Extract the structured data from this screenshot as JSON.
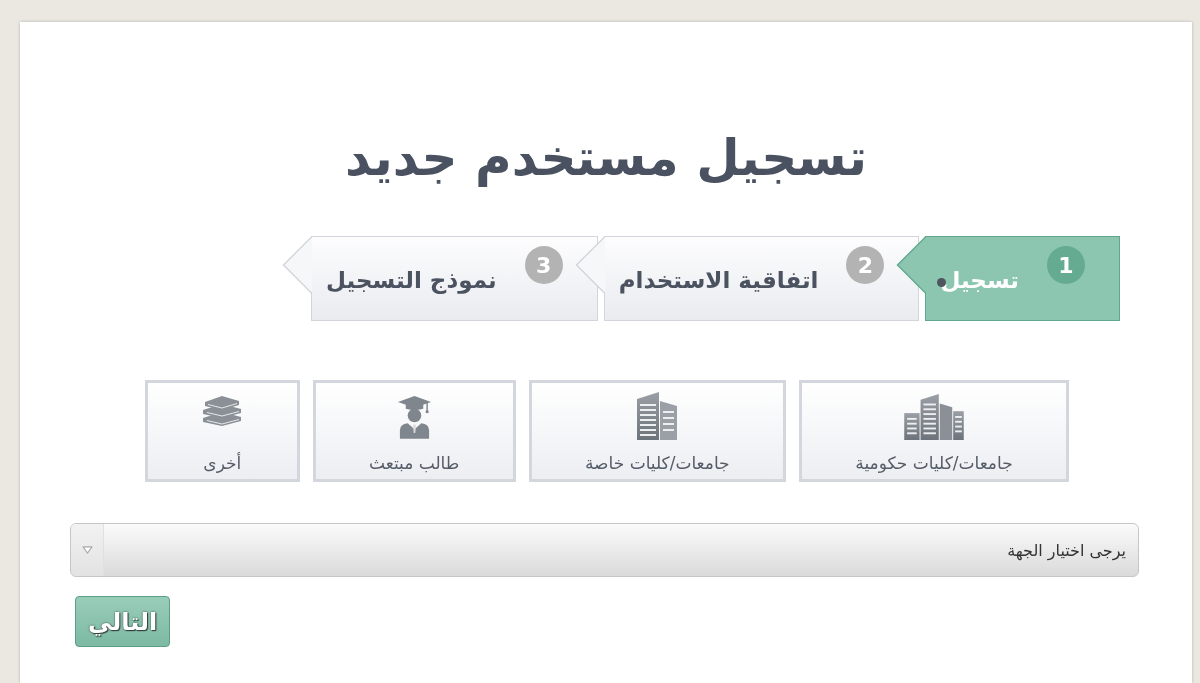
{
  "page": {
    "title": "تسجيل مستخدم جديد"
  },
  "steps": [
    {
      "number": "1",
      "label": "تسجيل",
      "selected": true,
      "dot": true
    },
    {
      "number": "2",
      "label": "اتفاقية الاستخدام",
      "selected": false,
      "dot": false
    },
    {
      "number": "3",
      "label": "نموذج التسجيل",
      "selected": false,
      "dot": false
    }
  ],
  "categories": [
    {
      "kind": "government",
      "label": "جامعات/كليات حكومية",
      "selected": false
    },
    {
      "kind": "private",
      "label": "جامعات/كليات خاصة",
      "selected": false
    },
    {
      "kind": "scholarship",
      "label": "طالب مبتعث",
      "selected": false
    },
    {
      "kind": "other",
      "label": "أخرى",
      "selected": false
    }
  ],
  "entity_select": {
    "placeholder": "يرجى اختيار الجهة"
  },
  "buttons": {
    "next": "التالي"
  }
}
